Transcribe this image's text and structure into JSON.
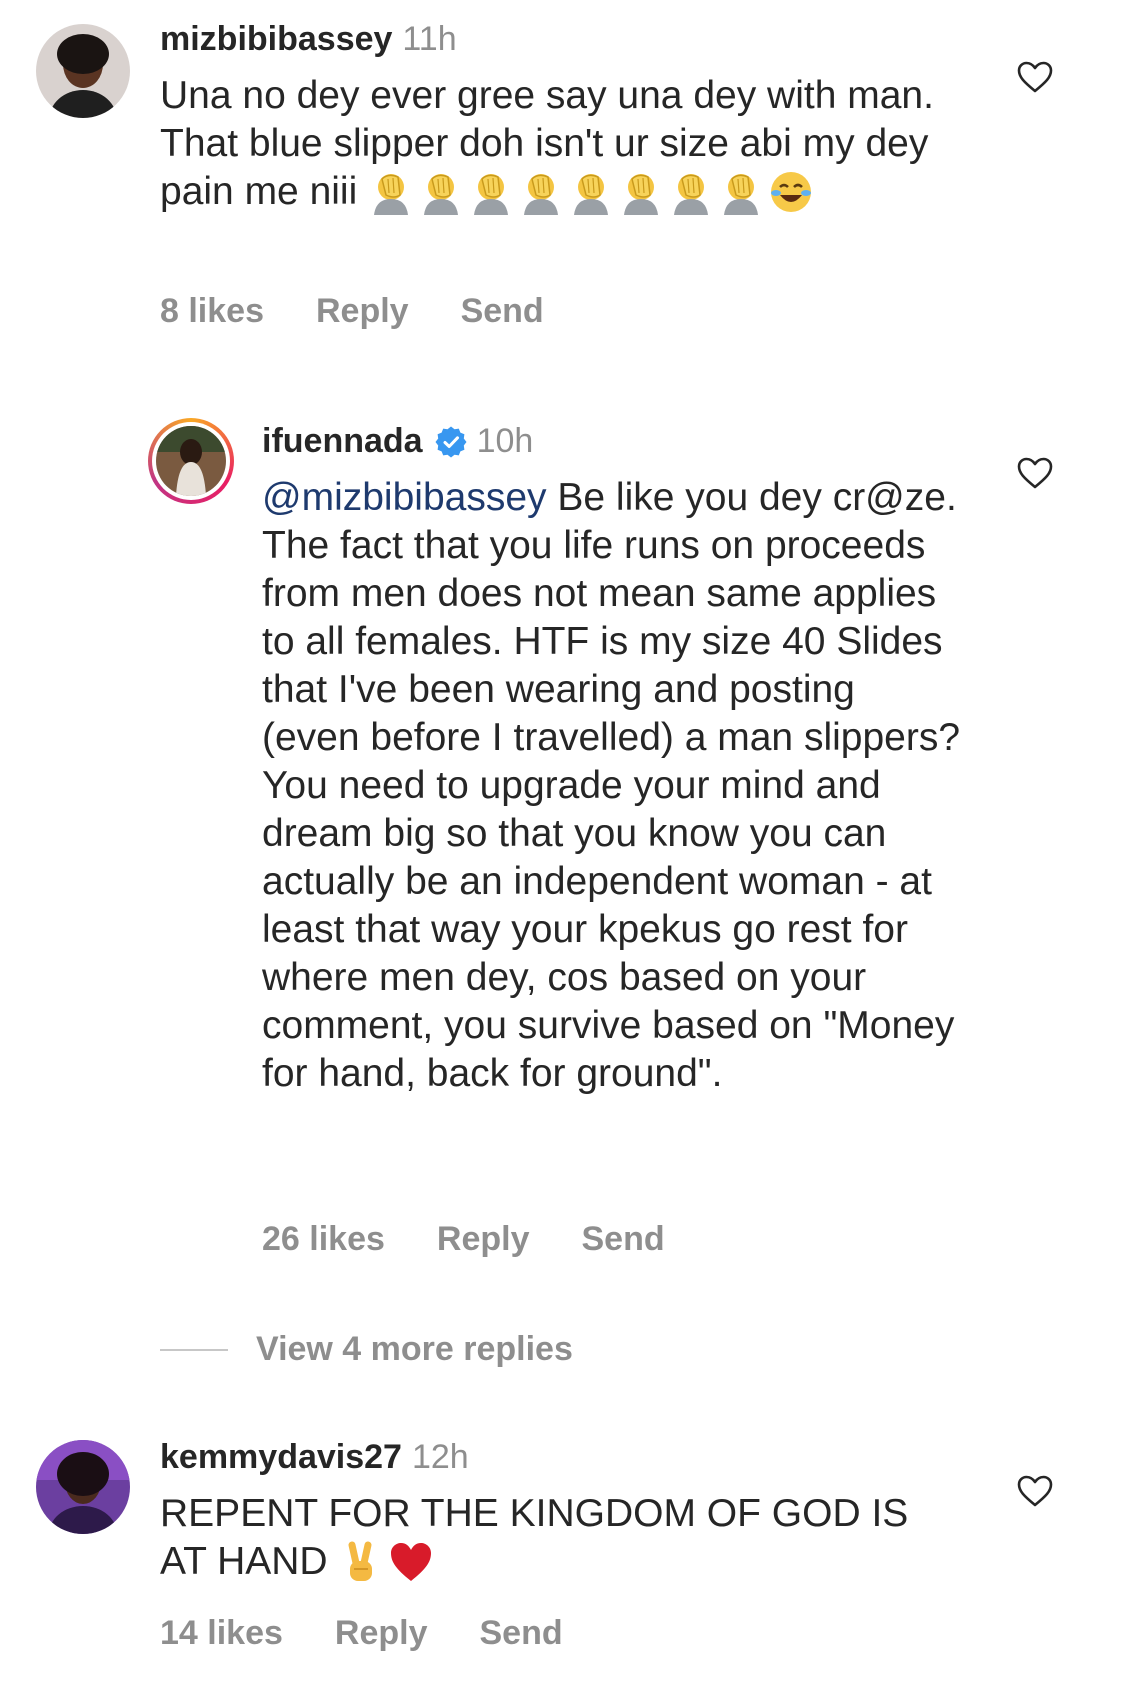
{
  "comments": [
    {
      "username": "mizbibibassey",
      "time": "11h",
      "text": "Una no dey ever gree say una dey with man. That blue slipper doh isn't ur size abi my dey pain me niii",
      "emojis": [
        "facepalm",
        "facepalm",
        "facepalm",
        "facepalm",
        "facepalm",
        "facepalm",
        "facepalm",
        "facepalm",
        "joy"
      ],
      "likes": "8 likes",
      "reply": "Reply",
      "send": "Send",
      "heart_icon": "heart-outline-icon"
    },
    {
      "username": "ifuennada",
      "verified": true,
      "time": "10h",
      "mention": "@mizbibibassey",
      "text": "Be like you dey cr@ze. The fact that you life runs on proceeds from men does not mean same applies to all females. HTF is my size 40 Slides that I've been wearing and posting (even before I travelled) a man slippers? You need to upgrade your mind and dream big so that you know you can actually be an independent woman - at least that way your kpekus go rest for where men dey, cos based on your comment, you survive based on \"Money for hand, back for ground\".",
      "likes": "26 likes",
      "reply": "Reply",
      "send": "Send",
      "heart_icon": "heart-outline-icon"
    },
    {
      "username": "kemmydavis27",
      "time": "12h",
      "text": "REPENT FOR THE KINGDOM OF GOD IS AT HAND",
      "emojis": [
        "victory-hand",
        "red-heart"
      ],
      "likes": "14 likes",
      "reply": "Reply",
      "send": "Send",
      "heart_icon": "heart-outline-icon"
    }
  ],
  "view_more": "View 4 more replies",
  "colors": {
    "text": "#262626",
    "secondary": "#8e8e8e",
    "mention": "#1e3a6e",
    "verified": "#3897f0"
  }
}
